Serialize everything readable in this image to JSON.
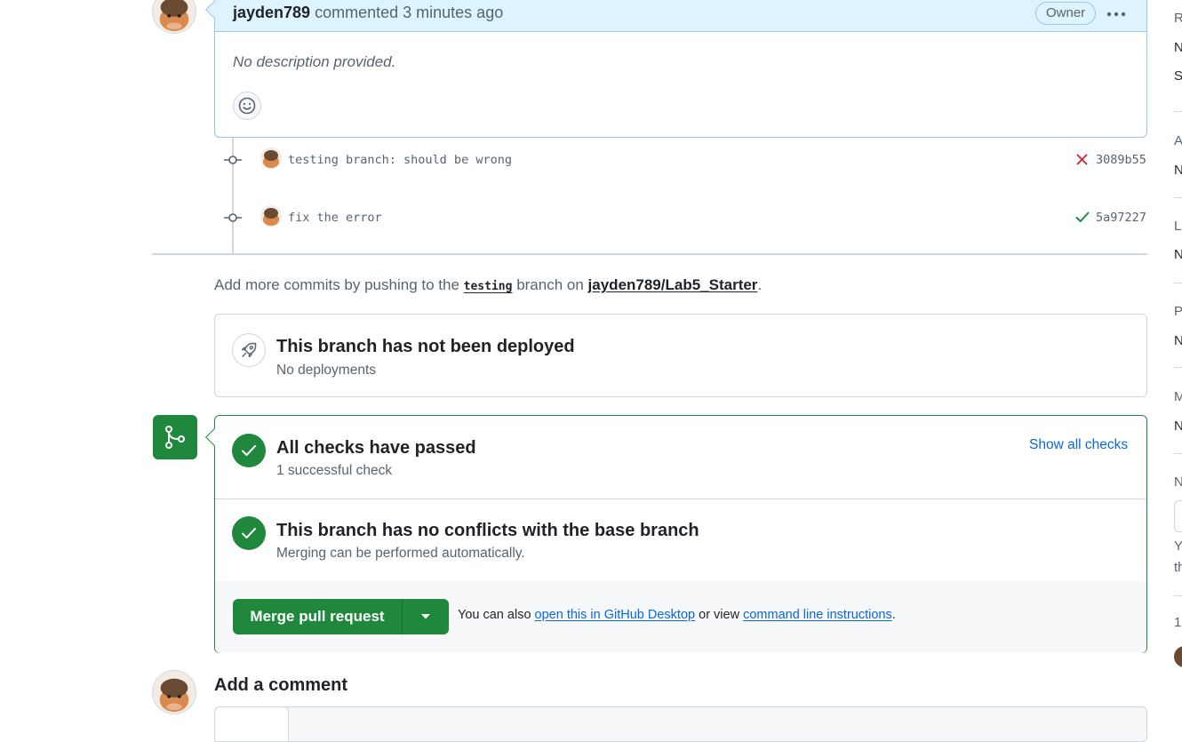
{
  "comment": {
    "author": "jayden789",
    "action": "commented",
    "time": "3 minutes ago",
    "badge": "Owner",
    "kebab_icon": "kebab-horizontal-icon",
    "body": "No description provided."
  },
  "commits": [
    {
      "message": "testing branch: should be wrong",
      "status": "failure",
      "sha": "3089b55"
    },
    {
      "message": "fix the error",
      "status": "success",
      "sha": "5a97227"
    }
  ],
  "push_note": {
    "prefix": "Add more commits by pushing to the",
    "branch": "testing",
    "middle": "branch on",
    "repo": "jayden789/Lab5_Starter",
    "suffix": "."
  },
  "deploy": {
    "title": "This branch has not been deployed",
    "subtitle": "No deployments",
    "icon": "rocket-icon"
  },
  "merge": {
    "checks_title": "All checks have passed",
    "checks_subtitle": "1 successful check",
    "show_checks": "Show all checks",
    "conflicts_title": "This branch has no conflicts with the base branch",
    "conflicts_subtitle": "Merging can be performed automatically.",
    "merge_button": "Merge pull request",
    "footer_prefix": "You can also",
    "desktop_link": "open this in GitHub Desktop",
    "footer_middle": "or view",
    "cli_link": "command line instructions",
    "footer_suffix": "."
  },
  "add_comment": {
    "title": "Add a comment"
  },
  "sidebar": {
    "fragments": [
      "R",
      "N",
      "S",
      "A",
      "N",
      "L",
      "N",
      "P",
      "N",
      "M",
      "N",
      "N",
      "Y",
      "th",
      "1"
    ]
  },
  "colors": {
    "green": "#1f883d",
    "blue_link": "#0969da",
    "fail_red": "#cf222e",
    "comment_header": "#ddf4ff"
  }
}
